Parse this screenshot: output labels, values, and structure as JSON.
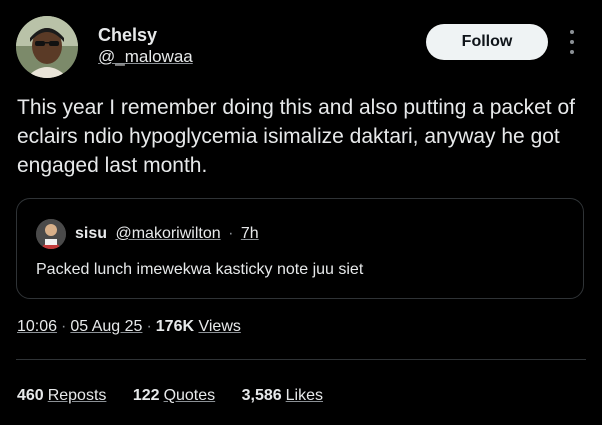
{
  "author": {
    "display_name": "Chelsy",
    "handle": "@_malowaa"
  },
  "header": {
    "follow_label": "Follow",
    "more_icon": "more-vertical-icon"
  },
  "tweet": {
    "text": "This year I remember doing this and also putting a packet of eclairs ndio hypoglycemia isimalize daktari, anyway he got engaged last month."
  },
  "quote": {
    "display_name": "sisu",
    "handle": "@makoriwilton",
    "separator": "·",
    "time": "7h",
    "text": "Packed lunch imewekwa kasticky note juu siet"
  },
  "meta": {
    "time": "10:06",
    "date": "05 Aug 25",
    "views_count": "176K",
    "views_label": "Views",
    "separator": "·"
  },
  "stats": {
    "reposts_count": "460",
    "reposts_label": "Reposts",
    "quotes_count": "122",
    "quotes_label": "Quotes",
    "likes_count": "3,586",
    "likes_label": "Likes"
  },
  "colors": {
    "background": "#000000",
    "text": "#e7e9ea",
    "muted": "#8b9095",
    "border": "#2f3336",
    "button_bg": "#eff3f4"
  }
}
